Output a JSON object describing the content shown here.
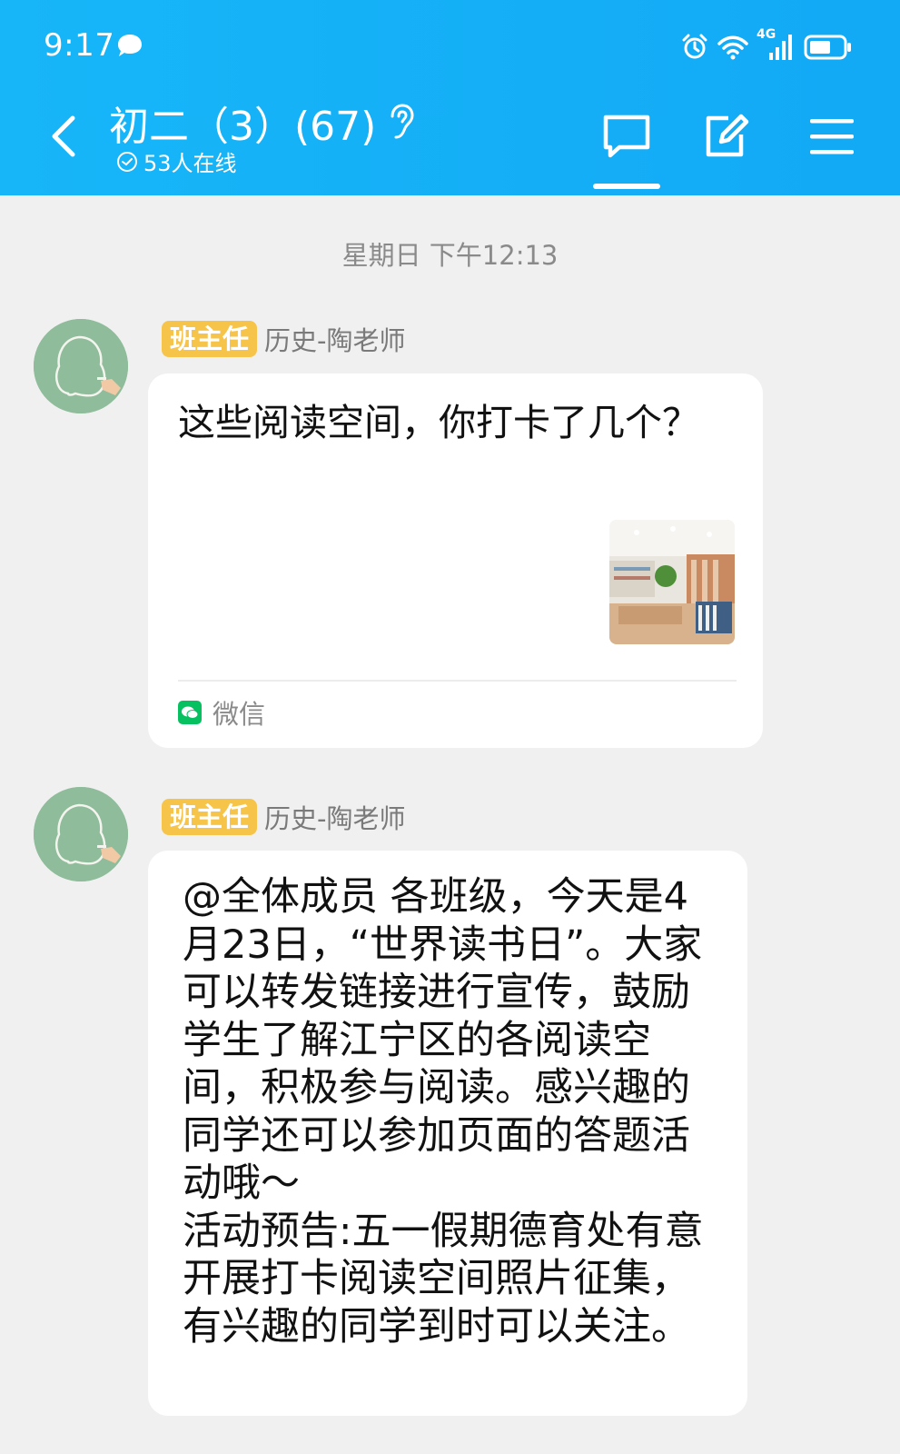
{
  "status_bar": {
    "time": "9:17",
    "network": "4G",
    "icons": [
      "message-icon",
      "alarm-icon",
      "wifi-icon",
      "signal-icon",
      "battery-icon"
    ]
  },
  "header": {
    "title": "初二（3）(67)",
    "online_status": "53人在线",
    "icons": [
      "back-icon",
      "ear-icon",
      "chat-icon",
      "edit-icon",
      "menu-icon"
    ]
  },
  "colors": {
    "header_bg": "#12a9f5",
    "badge_bg": "#f7c44a",
    "chat_bg": "#f0f0f0",
    "wechat_green": "#07c160"
  },
  "chat": {
    "day_stamp": "星期日 下午12:13",
    "messages": [
      {
        "badge": "班主任",
        "sender": "历史-陶老师",
        "text": "这些阅读空间，你打卡了几个？",
        "source": "微信",
        "has_thumbnail": true
      },
      {
        "badge": "班主任",
        "sender": "历史-陶老师",
        "text": "@全体成员 各班级，今天是4月23日，“世界读书日”。大家可以转发链接进行宣传，鼓励学生了解江宁区的各阅读空间，积极参与阅读。感兴趣的同学还可以参加页面的答题活动哦～\n活动预告:五一假期德育处有意开展打卡阅读空间照片征集，有兴趣的同学到时可以关注。"
      }
    ]
  }
}
